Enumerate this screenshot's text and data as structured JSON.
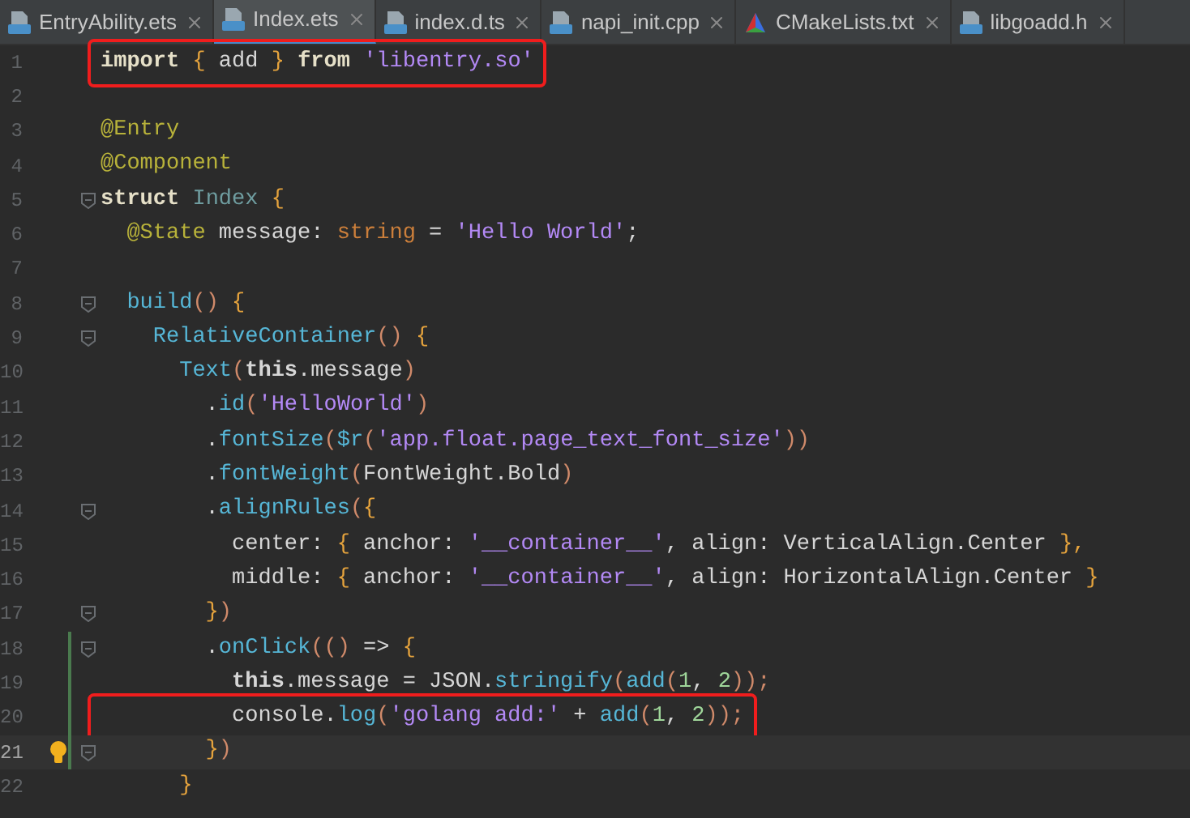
{
  "tabs": [
    {
      "label": "EntryAbility.ets",
      "kind": "ets",
      "selected": false
    },
    {
      "label": "Index.ets",
      "kind": "ets",
      "selected": true
    },
    {
      "label": "index.d.ts",
      "kind": "ts",
      "selected": false
    },
    {
      "label": "napi_init.cpp",
      "kind": "cpp",
      "selected": false
    },
    {
      "label": "CMakeLists.txt",
      "kind": "cmake",
      "selected": false
    },
    {
      "label": "libgoadd.h",
      "kind": "h",
      "selected": false
    }
  ],
  "editor": {
    "lines": [
      {
        "number": "1",
        "boxed": true,
        "current": false,
        "fold": false,
        "changed": false,
        "bulb": false,
        "tokens": [
          {
            "t": "**import** ",
            "color": "#e6e0c8"
          },
          {
            "t": "{",
            "color": "#e5a33d"
          },
          {
            "t": " add ",
            "color": "#d6d6d6"
          },
          {
            "t": "}",
            "color": "#e5a33d"
          },
          {
            "t": " **from** ",
            "color": "#e6e0c8"
          },
          {
            "t": "'libentry.so'",
            "color": "#b389f5"
          }
        ]
      },
      {
        "number": "2",
        "boxed": false,
        "current": false,
        "fold": false,
        "changed": false,
        "bulb": false
      },
      {
        "number": "3",
        "boxed": false,
        "current": false,
        "fold": false,
        "changed": false,
        "bulb": false,
        "tokens": [
          {
            "t": "@Entry",
            "color": "#b8b23a"
          }
        ]
      },
      {
        "number": "4",
        "boxed": false,
        "current": false,
        "fold": false,
        "changed": false,
        "bulb": false,
        "tokens": [
          {
            "t": "@Component",
            "color": "#b8b23a"
          }
        ]
      },
      {
        "number": "5",
        "boxed": false,
        "current": false,
        "fold": true,
        "changed": false,
        "bulb": false,
        "tokens": [
          {
            "t": "**struct** ",
            "color": "#e6e0c8"
          },
          {
            "t": "Index ",
            "color": "#6f9da0"
          },
          {
            "t": "{",
            "color": "#e5a33d"
          }
        ]
      },
      {
        "number": "6",
        "boxed": false,
        "current": false,
        "fold": false,
        "changed": false,
        "bulb": false,
        "tokens": [
          {
            "t": "  @State",
            "color": "#b8b23a"
          },
          {
            "t": " message: ",
            "color": "#d6d6d6"
          },
          {
            "t": "string",
            "color": "#cc7f3b"
          },
          {
            "t": " = ",
            "color": "#d6d6d6"
          },
          {
            "t": "'Hello World'",
            "color": "#b389f5"
          },
          {
            "t": ";",
            "color": "#d6d6d6"
          }
        ]
      },
      {
        "number": "7",
        "boxed": false,
        "current": false,
        "fold": false,
        "changed": false,
        "bulb": false
      },
      {
        "number": "8",
        "boxed": false,
        "current": false,
        "fold": true,
        "changed": false,
        "bulb": false,
        "tokens": [
          {
            "t": "  build",
            "color": "#56b6d6"
          },
          {
            "t": "() ",
            "color": "#d08a6a"
          },
          {
            "t": "{",
            "color": "#e5a33d"
          }
        ]
      },
      {
        "number": "9",
        "boxed": false,
        "current": false,
        "fold": true,
        "changed": false,
        "bulb": false,
        "tokens": [
          {
            "t": "    RelativeContainer",
            "color": "#56b6d6"
          },
          {
            "t": "() ",
            "color": "#d08a6a"
          },
          {
            "t": "{",
            "color": "#e5a33d"
          }
        ]
      },
      {
        "number": "10",
        "boxed": false,
        "current": false,
        "fold": false,
        "changed": false,
        "bulb": false,
        "tokens": [
          {
            "t": "      Text",
            "color": "#56b6d6"
          },
          {
            "t": "(",
            "color": "#d08a6a"
          },
          {
            "t": "**this**.message",
            "color": "#d6d6d6"
          },
          {
            "t": ")",
            "color": "#d08a6a"
          }
        ]
      },
      {
        "number": "11",
        "boxed": false,
        "current": false,
        "fold": false,
        "changed": false,
        "bulb": false,
        "tokens": [
          {
            "t": "        .",
            "color": "#d6d6d6"
          },
          {
            "t": "id",
            "color": "#56b6d6"
          },
          {
            "t": "(",
            "color": "#d08a6a"
          },
          {
            "t": "'HelloWorld'",
            "color": "#b389f5"
          },
          {
            "t": ")",
            "color": "#d08a6a"
          }
        ]
      },
      {
        "number": "12",
        "boxed": false,
        "current": false,
        "fold": false,
        "changed": false,
        "bulb": false,
        "tokens": [
          {
            "t": "        .",
            "color": "#d6d6d6"
          },
          {
            "t": "fontSize",
            "color": "#56b6d6"
          },
          {
            "t": "(",
            "color": "#d08a6a"
          },
          {
            "t": "$r",
            "color": "#56b6d6"
          },
          {
            "t": "(",
            "color": "#d08a6a"
          },
          {
            "t": "'app.float.page_text_font_size'",
            "color": "#b389f5"
          },
          {
            "t": "))",
            "color": "#d08a6a"
          }
        ]
      },
      {
        "number": "13",
        "boxed": false,
        "current": false,
        "fold": false,
        "changed": false,
        "bulb": false,
        "tokens": [
          {
            "t": "        .",
            "color": "#d6d6d6"
          },
          {
            "t": "fontWeight",
            "color": "#56b6d6"
          },
          {
            "t": "(",
            "color": "#d08a6a"
          },
          {
            "t": "FontWeight.Bold",
            "color": "#d6d6d6"
          },
          {
            "t": ")",
            "color": "#d08a6a"
          }
        ]
      },
      {
        "number": "14",
        "boxed": false,
        "current": false,
        "fold": true,
        "changed": false,
        "bulb": false,
        "tokens": [
          {
            "t": "        .",
            "color": "#d6d6d6"
          },
          {
            "t": "alignRules",
            "color": "#56b6d6"
          },
          {
            "t": "(",
            "color": "#d08a6a"
          },
          {
            "t": "{",
            "color": "#e5a33d"
          }
        ]
      },
      {
        "number": "15",
        "boxed": false,
        "current": false,
        "fold": false,
        "changed": false,
        "bulb": false,
        "tokens": [
          {
            "t": "          center: ",
            "color": "#d6d6d6"
          },
          {
            "t": "{",
            "color": "#e5a33d"
          },
          {
            "t": " anchor: ",
            "color": "#d6d6d6"
          },
          {
            "t": "'__container__'",
            "color": "#b389f5"
          },
          {
            "t": ", align: VerticalAlign.Center ",
            "color": "#d6d6d6"
          },
          {
            "t": "},",
            "color": "#e5a33d"
          }
        ]
      },
      {
        "number": "16",
        "boxed": false,
        "current": false,
        "fold": false,
        "changed": false,
        "bulb": false,
        "tokens": [
          {
            "t": "          middle: ",
            "color": "#d6d6d6"
          },
          {
            "t": "{",
            "color": "#e5a33d"
          },
          {
            "t": " anchor: ",
            "color": "#d6d6d6"
          },
          {
            "t": "'__container__'",
            "color": "#b389f5"
          },
          {
            "t": ", align: HorizontalAlign.Center ",
            "color": "#d6d6d6"
          },
          {
            "t": "}",
            "color": "#e5a33d"
          }
        ]
      },
      {
        "number": "17",
        "boxed": false,
        "current": false,
        "fold": true,
        "changed": false,
        "bulb": false,
        "tokens": [
          {
            "t": "        }",
            "color": "#e5a33d"
          },
          {
            "t": ")",
            "color": "#d08a6a"
          }
        ]
      },
      {
        "number": "18",
        "boxed": false,
        "current": false,
        "fold": true,
        "changed": true,
        "bulb": false,
        "tokens": [
          {
            "t": "        .",
            "color": "#d6d6d6"
          },
          {
            "t": "onClick",
            "color": "#56b6d6"
          },
          {
            "t": "(() ",
            "color": "#d08a6a"
          },
          {
            "t": "=> ",
            "color": "#d6d6d6"
          },
          {
            "t": "{",
            "color": "#e5a33d"
          }
        ]
      },
      {
        "number": "19",
        "boxed": false,
        "current": false,
        "fold": false,
        "changed": true,
        "bulb": false,
        "tokens": [
          {
            "t": "          **this**.message = JSON.",
            "color": "#d6d6d6"
          },
          {
            "t": "stringify",
            "color": "#56b6d6"
          },
          {
            "t": "(",
            "color": "#d08a6a"
          },
          {
            "t": "add",
            "color": "#56b6d6"
          },
          {
            "t": "(",
            "color": "#d08a6a"
          },
          {
            "t": "1",
            "color": "#9fd69a"
          },
          {
            "t": ", ",
            "color": "#d6d6d6"
          },
          {
            "t": "2",
            "color": "#9fd69a"
          },
          {
            "t": "));",
            "color": "#d08a6a"
          }
        ]
      },
      {
        "number": "20",
        "boxed": true,
        "current": false,
        "fold": false,
        "changed": true,
        "bulb": false,
        "tokens": [
          {
            "t": "          console.",
            "color": "#d6d6d6"
          },
          {
            "t": "log",
            "color": "#56b6d6"
          },
          {
            "t": "(",
            "color": "#d08a6a"
          },
          {
            "t": "'golang add:'",
            "color": "#b389f5"
          },
          {
            "t": " + ",
            "color": "#d6d6d6"
          },
          {
            "t": "add",
            "color": "#56b6d6"
          },
          {
            "t": "(",
            "color": "#d08a6a"
          },
          {
            "t": "1",
            "color": "#9fd69a"
          },
          {
            "t": ", ",
            "color": "#d6d6d6"
          },
          {
            "t": "2",
            "color": "#9fd69a"
          },
          {
            "t": "));",
            "color": "#d08a6a"
          }
        ]
      },
      {
        "number": "21",
        "boxed": false,
        "current": true,
        "fold": true,
        "changed": true,
        "bulb": true,
        "tokens": [
          {
            "t": "        }",
            "color": "#e5a33d"
          },
          {
            "t": ")",
            "color": "#d08a6a"
          }
        ]
      },
      {
        "number": "22",
        "boxed": false,
        "current": false,
        "fold": false,
        "changed": false,
        "bulb": false,
        "tokens": [
          {
            "t": "      }",
            "color": "#e5a33d"
          }
        ]
      }
    ]
  }
}
